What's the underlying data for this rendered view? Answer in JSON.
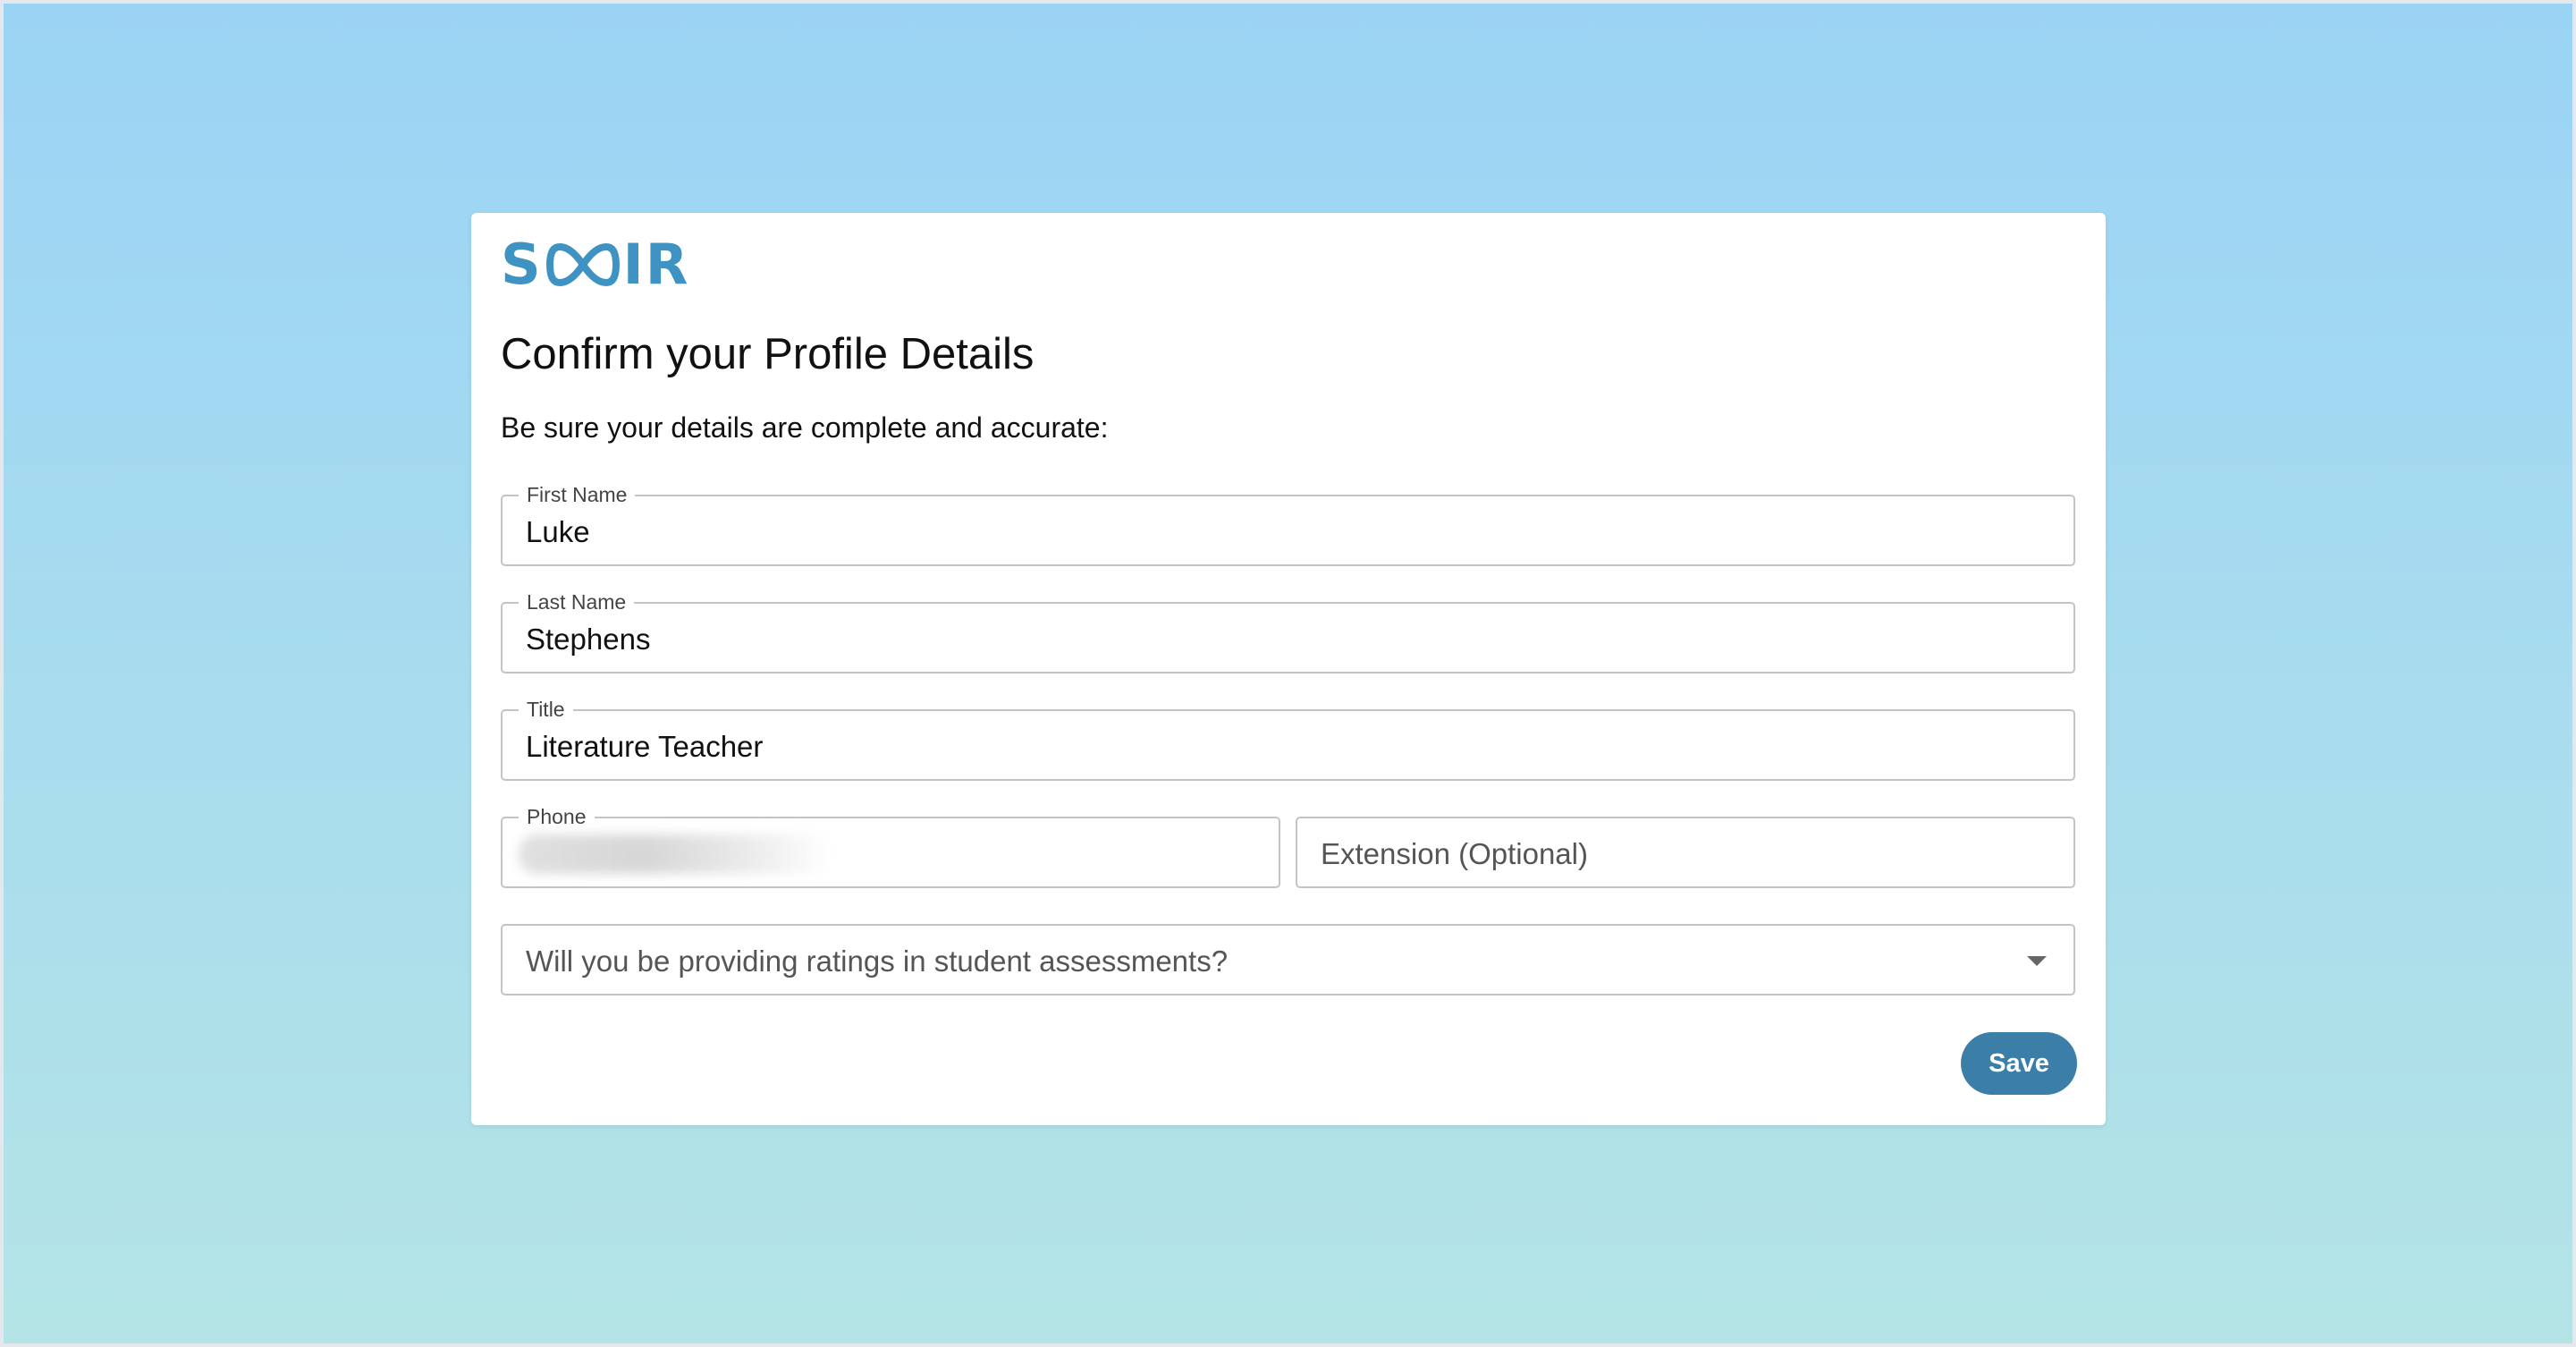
{
  "brand": {
    "logo_text_left": "S",
    "logo_text_right": "IR",
    "color": "#3e93c2"
  },
  "page": {
    "title": "Confirm your Profile Details",
    "subtitle": "Be sure your details are complete and accurate:"
  },
  "form": {
    "first_name": {
      "label": "First Name",
      "value": "Luke"
    },
    "last_name": {
      "label": "Last Name",
      "value": "Stephens"
    },
    "title": {
      "label": "Title",
      "value": "Literature Teacher"
    },
    "phone": {
      "label": "Phone",
      "value_redacted": true
    },
    "extension": {
      "placeholder": "Extension (Optional)"
    },
    "ratings_select": {
      "placeholder": "Will you be providing ratings in student assessments?",
      "icon": "chevron-down-icon"
    }
  },
  "actions": {
    "save_label": "Save",
    "save_color": "#3b7fa9"
  }
}
